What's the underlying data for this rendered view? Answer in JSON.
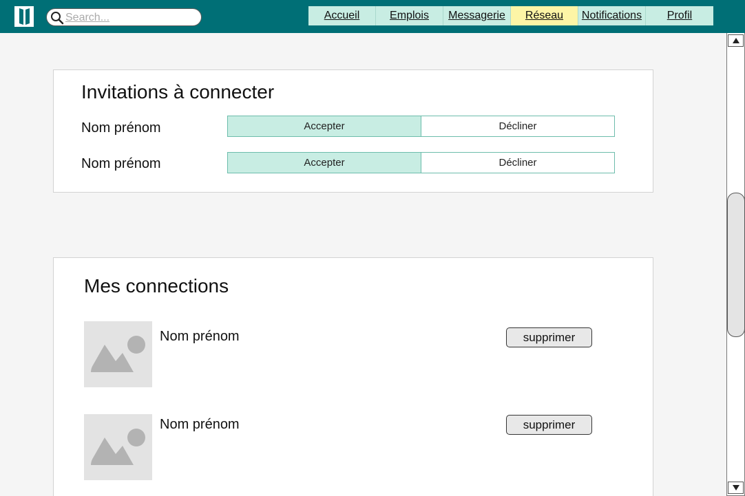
{
  "search": {
    "placeholder": "Search..."
  },
  "nav": {
    "items": [
      {
        "label": "Accueil"
      },
      {
        "label": "Emplois"
      },
      {
        "label": "Messagerie"
      },
      {
        "label": "Réseau",
        "active": true
      },
      {
        "label": "Notifications"
      },
      {
        "label": "Profil"
      }
    ]
  },
  "invitations": {
    "title": "Invitations à connecter",
    "items": [
      {
        "name": "Nom prénom",
        "accept_label": "Accepter",
        "decline_label": "Décliner"
      },
      {
        "name": "Nom prénom",
        "accept_label": "Accepter",
        "decline_label": "Décliner"
      }
    ]
  },
  "connections": {
    "title": "Mes connections",
    "items": [
      {
        "name": "Nom prénom",
        "delete_label": "supprimer",
        "icon": "image-placeholder-icon"
      },
      {
        "name": "Nom prénom",
        "delete_label": "supprimer",
        "icon": "image-placeholder-icon"
      }
    ]
  },
  "colors": {
    "topbar": "#006f76",
    "nav_bg": "#c8ede3",
    "nav_active": "#fdf5a6",
    "accept_bg": "#c8ede3"
  }
}
